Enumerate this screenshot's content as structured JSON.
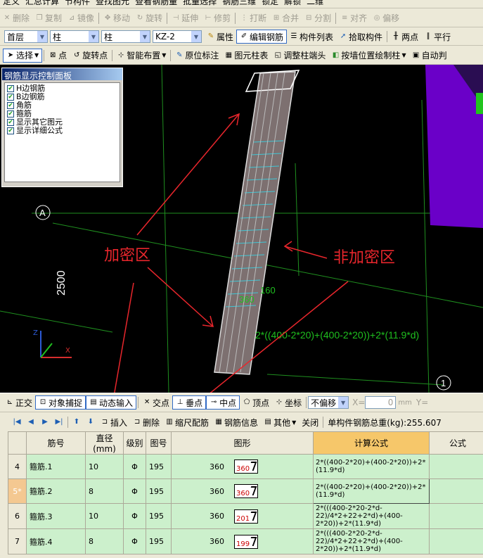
{
  "toolbar1": {
    "items": [
      "定义",
      "汇总计算",
      "节构件",
      "查找图元",
      "查看钢筋量",
      "批量选择",
      "钢筋三维",
      "锁定",
      "解锁",
      "二维"
    ]
  },
  "toolbar2": {
    "items": [
      "删除",
      "复制",
      "镜像",
      "移动",
      "旋转",
      "延伸",
      "修剪",
      "打断",
      "合并",
      "分割",
      "对齐",
      "偏移"
    ]
  },
  "toolbar3": {
    "floor": "首层",
    "type1": "柱",
    "type2": "柱",
    "element": "KZ-2",
    "items": [
      "属性",
      "编辑钢筋",
      "构件列表",
      "拾取构件",
      "两点",
      "平行"
    ]
  },
  "toolbar4": {
    "items": [
      "选择",
      "点",
      "旋转点",
      "智能布置",
      "原位标注",
      "图元柱表",
      "调整柱端头",
      "按墙位置绘制柱",
      "自动判"
    ]
  },
  "control_panel": {
    "title": "钢筋显示控制面板",
    "options": [
      "H边钢筋",
      "B边钢筋",
      "角筋",
      "箍筋",
      "显示其它图元",
      "显示详细公式"
    ]
  },
  "viewport": {
    "axis_label": "A",
    "axis_number": "1",
    "dimension": "2500",
    "annotations": {
      "dense_zone": "加密区",
      "non_dense_zone": "非加密区"
    },
    "formula_text": "2*((400-2*20)+(400-2*20))+2*(11.9*d)",
    "green_labels": [
      "160",
      "360"
    ],
    "coord_x": "X",
    "coord_z": "Z"
  },
  "snapbar": {
    "items": [
      "正交",
      "对象捕捉",
      "动态输入",
      "交点",
      "垂点",
      "中点",
      "顶点",
      "坐标"
    ],
    "offset_select": "不偏移",
    "x_label": "X=",
    "x_value": "0",
    "unit": "mm",
    "y_label": "Y="
  },
  "gridbar": {
    "items": [
      "插入",
      "删除",
      "缩尺配筋",
      "钢筋信息",
      "其他",
      "关闭"
    ],
    "total_weight": "单构件钢筋总重(kg):255.607"
  },
  "table": {
    "headers": [
      "筋号",
      "直径(mm)",
      "级别",
      "图号",
      "图形",
      "计算公式",
      "公式"
    ],
    "rows": [
      {
        "index": "4",
        "name": "箍筋.1",
        "diameter": "10",
        "grade": "Φ",
        "code": "195",
        "len": "360",
        "shape_val": "360",
        "formula": "2*((400-2*20)+(400-2*20))+2*(11.9*d)"
      },
      {
        "index": "5*",
        "name": "箍筋.2",
        "diameter": "8",
        "grade": "Φ",
        "code": "195",
        "len": "360",
        "shape_val": "360",
        "formula": "2*((400-2*20)+(400-2*20))+2*(11.9*d)"
      },
      {
        "index": "6",
        "name": "箍筋.3",
        "diameter": "10",
        "grade": "Φ",
        "code": "195",
        "len": "360",
        "shape_val": "201",
        "formula": "2*(((400-2*20-2*d-22)/4*2+22+2*d)+(400-2*20))+2*(11.9*d)"
      },
      {
        "index": "7",
        "name": "箍筋.4",
        "diameter": "8",
        "grade": "Φ",
        "code": "195",
        "len": "360",
        "shape_val": "199",
        "formula": "2*(((400-2*20-2*d-22)/4*2+22+2*d)+(400-2*20))+2*(11.9*d)"
      }
    ]
  },
  "colors": {
    "annotation": "#e8262c",
    "grid_line": "#1f8f1f",
    "rebar": "#7d7070",
    "stirrup": "#3fc7d6",
    "purple_block": "#6a00c8"
  }
}
